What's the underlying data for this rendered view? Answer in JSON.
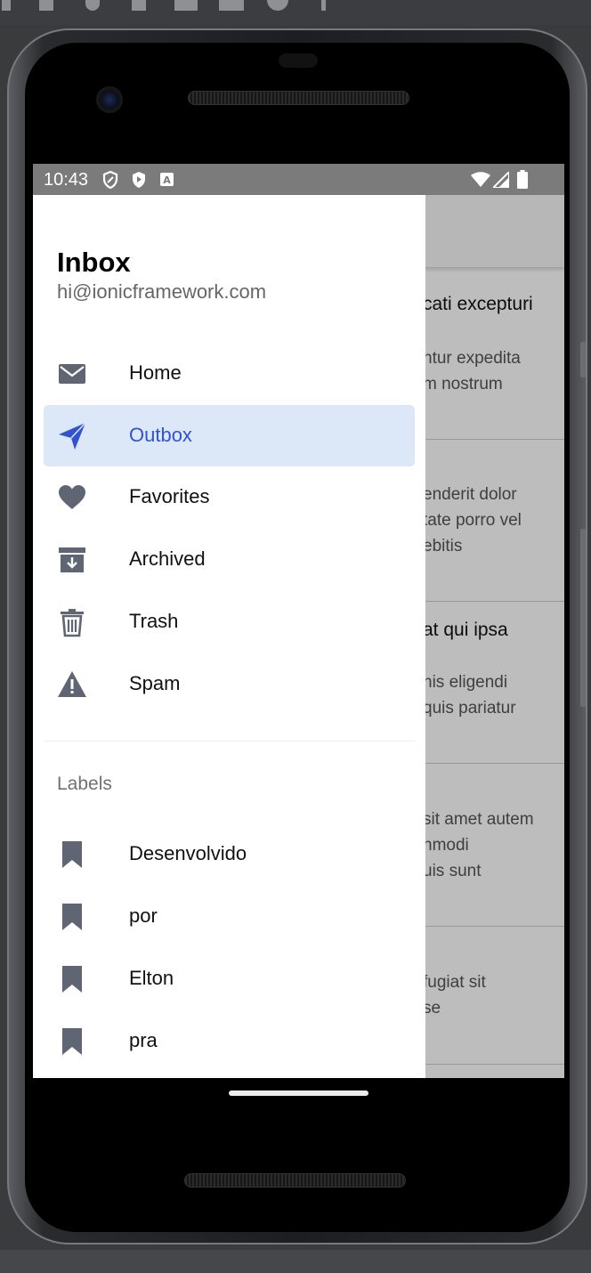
{
  "status_bar": {
    "time": "10:43",
    "icons": [
      "shield-outline-icon",
      "play-protect-icon",
      "keyboard-a-icon",
      "wifi-icon",
      "signal-icon",
      "battery-icon"
    ]
  },
  "drawer": {
    "title": "Inbox",
    "email": "hi@ionicframework.com",
    "menu": [
      {
        "label": "Home",
        "icon": "mail-icon",
        "selected": false
      },
      {
        "label": "Outbox",
        "icon": "paper-plane-icon",
        "selected": true
      },
      {
        "label": "Favorites",
        "icon": "heart-icon",
        "selected": false
      },
      {
        "label": "Archived",
        "icon": "archive-icon",
        "selected": false
      },
      {
        "label": "Trash",
        "icon": "trash-icon",
        "selected": false
      },
      {
        "label": "Spam",
        "icon": "warning-icon",
        "selected": false
      }
    ],
    "labels_heading": "Labels",
    "labels": [
      {
        "label": "Desenvolvido",
        "icon": "bookmark-icon"
      },
      {
        "label": "por",
        "icon": "bookmark-icon"
      },
      {
        "label": "Elton",
        "icon": "bookmark-icon"
      },
      {
        "label": "pra",
        "icon": "bookmark-icon"
      }
    ]
  },
  "background_list": {
    "items": [
      {
        "subject": "cati excepturi",
        "lines": [
          "ntur expedita",
          "m nostrum"
        ]
      },
      {
        "subject": "",
        "lines": [
          "enderit dolor",
          "tate porro vel",
          "ebitis"
        ]
      },
      {
        "subject": "at qui ipsa",
        "lines": [
          "nis eligendi",
          "quis pariatur"
        ]
      },
      {
        "subject": "",
        "lines": [
          "sit amet autem",
          "nmodi",
          "uis sunt"
        ]
      },
      {
        "subject": "",
        "lines": [
          " fugiat sit",
          "se"
        ]
      }
    ]
  },
  "colors": {
    "accent": "#3253d0",
    "selected_bg": "#dce7f8",
    "icon_gray": "#5f6573",
    "statusbar": "#7b7b7b"
  }
}
